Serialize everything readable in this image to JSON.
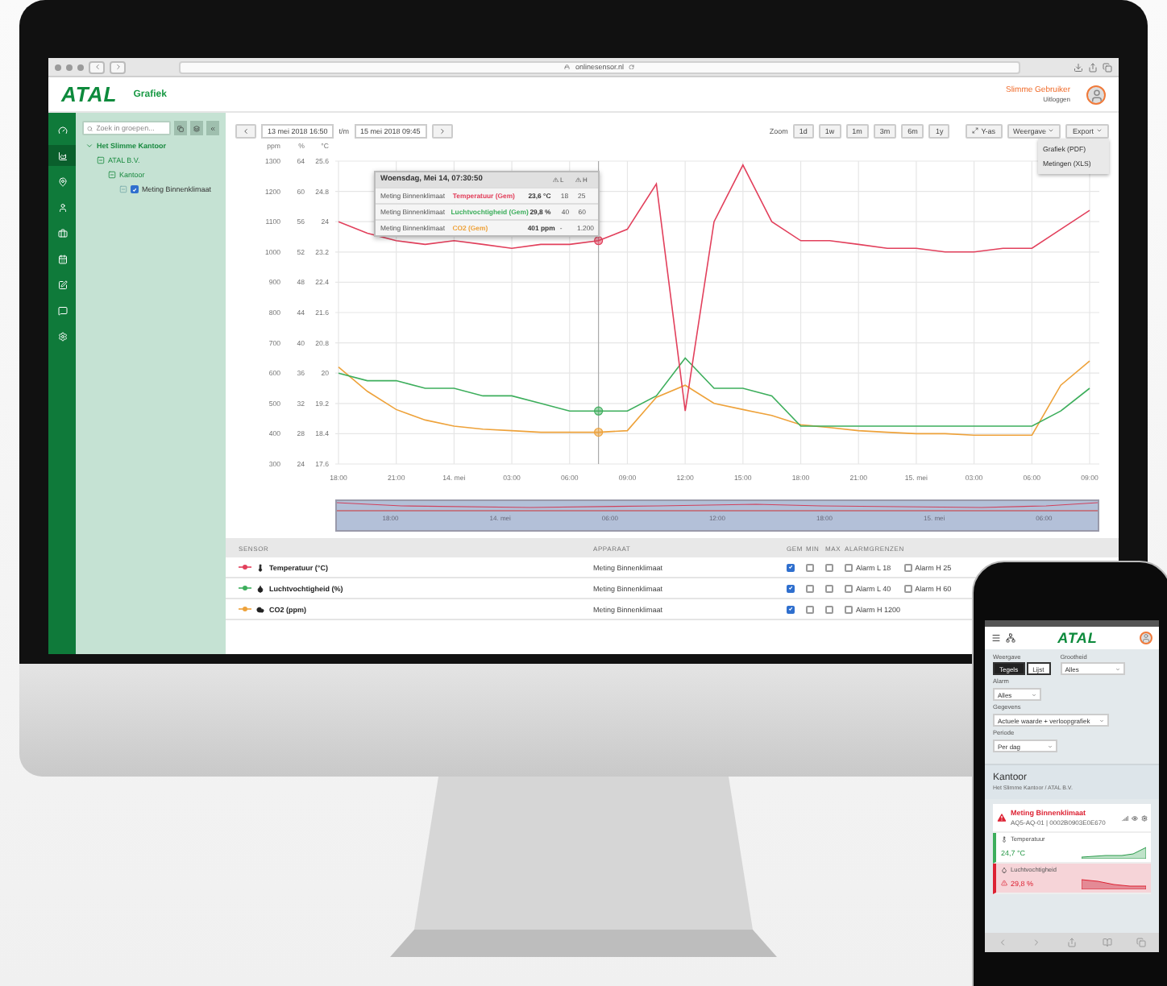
{
  "browser": {
    "url": "onlinesensor.nl"
  },
  "header": {
    "logo": "ATAL",
    "page_title": "Grafiek",
    "user_name": "Slimme Gebruiker",
    "logout": "Uitloggen"
  },
  "rail": {
    "items": [
      {
        "kind": "gauge",
        "selected": false
      },
      {
        "kind": "chart",
        "selected": true
      },
      {
        "kind": "pin",
        "selected": false
      },
      {
        "kind": "user",
        "selected": false
      },
      {
        "kind": "case",
        "selected": false
      },
      {
        "kind": "calendar",
        "selected": false
      },
      {
        "kind": "edit",
        "selected": false
      },
      {
        "kind": "message",
        "selected": false
      },
      {
        "kind": "settings",
        "selected": false
      }
    ]
  },
  "sidebar": {
    "search_placeholder": "Zoek in groepen...",
    "tree": [
      {
        "label": "Het Slimme Kantoor",
        "expanded": true,
        "children": [
          {
            "label": "ATAL B.V.",
            "expanded": true,
            "children": [
              {
                "label": "Kantoor",
                "expanded": true,
                "children": [
                  {
                    "label": "Meting Binnenklimaat",
                    "checked": true
                  }
                ]
              }
            ]
          }
        ]
      }
    ]
  },
  "toolbar": {
    "from": "13 mei 2018 16:50",
    "between": "t/m",
    "to": "15 mei 2018 09:45",
    "zoom_label": "Zoom",
    "zoom_options": [
      {
        "label": "1d",
        "selected": false
      },
      {
        "label": "1w",
        "selected": false
      },
      {
        "label": "1m",
        "selected": false
      },
      {
        "label": "3m",
        "selected": false
      },
      {
        "label": "6m",
        "selected": false
      },
      {
        "label": "1y",
        "selected": false
      }
    ],
    "yaxis_button": "Y-as",
    "view_menu": "Weergave",
    "export_menu": "Export",
    "export_options": [
      "Grafiek (PDF)",
      "Metingen (XLS)"
    ]
  },
  "chart": {
    "axes": [
      {
        "chart_data": {
          "type": "line",
          "ylabel": "ppm",
          "grid": true,
          "categories": [
            "18:00",
            null,
            "21:00",
            null,
            "14. mei",
            null,
            "03:00",
            null,
            "06:00",
            null,
            "09:00",
            null,
            "12:00",
            null,
            "15:00",
            null,
            "18:00",
            null,
            "21:00",
            null,
            "15. mei",
            null,
            "03:00",
            null,
            "06:00",
            null,
            "09:00"
          ],
          "ylim": [
            300,
            1300
          ],
          "yticks": [
            300,
            400,
            500,
            600,
            700,
            800,
            900,
            1000,
            1100,
            1200,
            1300
          ],
          "series": [
            {
              "color": "#eea23a",
              "values": [
                620,
                540,
                480,
                445,
                425,
                415,
                410,
                405,
                405,
                405,
                410,
                520,
                560,
                500,
                480,
                460,
                430,
                420,
                410,
                405,
                400,
                400,
                395,
                395,
                395,
                560,
                640
              ]
            }
          ]
        }
      },
      {
        "chart_data": {
          "type": "line",
          "ylabel": "%",
          "categories": [
            null,
            null,
            null,
            null,
            null,
            null,
            null,
            null,
            null,
            null,
            null,
            null,
            null,
            null,
            null,
            null,
            null,
            null,
            null,
            null,
            null,
            null,
            null,
            null,
            null,
            null,
            null
          ],
          "ylim": [
            24,
            64
          ],
          "yticks": [
            24,
            28,
            32,
            36,
            40,
            44,
            48,
            52,
            56,
            60,
            64
          ],
          "series": [
            {
              "color": "#3dae5c",
              "values": [
                36,
                35,
                35,
                34,
                34,
                33,
                33,
                32,
                31,
                31,
                31,
                33,
                38,
                34,
                34,
                33,
                29,
                29,
                29,
                29,
                29,
                29,
                29,
                29,
                29,
                31,
                34
              ]
            }
          ]
        }
      },
      {
        "chart_data": {
          "type": "line",
          "ylabel": "°C",
          "categories": [
            null,
            null,
            null,
            null,
            null,
            null,
            null,
            null,
            null,
            null,
            null,
            null,
            null,
            null,
            null,
            null,
            null,
            null,
            null,
            null,
            null,
            null,
            null,
            null,
            null,
            null,
            null
          ],
          "ylim": [
            17.6,
            25.6
          ],
          "yticks": [
            17.6,
            18.4,
            19.2,
            20,
            20.8,
            21.6,
            22.4,
            23.2,
            24,
            24.8,
            25.6
          ],
          "series": [
            {
              "color": "#e2405c",
              "values": [
                24.0,
                23.7,
                23.5,
                23.4,
                23.5,
                23.4,
                23.3,
                23.4,
                23.4,
                23.5,
                23.8,
                25.0,
                19.0,
                24.0,
                25.5,
                24.0,
                23.5,
                23.5,
                23.4,
                23.3,
                23.3,
                23.2,
                23.2,
                23.3,
                23.3,
                23.8,
                24.3
              ]
            }
          ]
        }
      }
    ],
    "tooltip": {
      "title": "Woensdag, Mei 14, 07:30:50",
      "low_header": "L",
      "high_header": "H",
      "rows": [
        {
          "device": "Meting Binnenklimaat",
          "sensor": "Temperatuur (Gem)",
          "color": "#e2405c",
          "value": "23,6 °C",
          "low": "18",
          "high": "25"
        },
        {
          "device": "Meting Binnenklimaat",
          "sensor": "Luchtvochtigheid (Gem)",
          "color": "#3dae5c",
          "value": "29,8 %",
          "low": "40",
          "high": "60"
        },
        {
          "device": "Meting Binnenklimaat",
          "sensor": "CO2 (Gem)",
          "color": "#eea23a",
          "value": "401 ppm",
          "low": "-",
          "high": "1.200"
        }
      ]
    },
    "navigator_labels": [
      "18:00",
      "14. mei",
      "06:00",
      "12:00",
      "18:00",
      "15. mei",
      "06:00"
    ]
  },
  "table": {
    "columns": [
      "SENSOR",
      "APPARAAT",
      "GEM",
      "MIN",
      "MAX",
      "ALARMGRENZEN"
    ],
    "rows": [
      {
        "kind": "temperature",
        "color": "#e2405c",
        "sensor": "Temperatuur (°C)",
        "device": "Meting Binnenklimaat",
        "gem": true,
        "min": false,
        "max": false,
        "alarms": [
          {
            "label": "Alarm L 18",
            "checked": false
          },
          {
            "label": "Alarm H 25",
            "checked": false
          }
        ]
      },
      {
        "kind": "humidity",
        "color": "#3dae5c",
        "sensor": "Luchtvochtigheid (%)",
        "device": "Meting Binnenklimaat",
        "gem": true,
        "min": false,
        "max": false,
        "alarms": [
          {
            "label": "Alarm L 40",
            "checked": false
          },
          {
            "label": "Alarm H 60",
            "checked": false
          }
        ]
      },
      {
        "kind": "co2",
        "color": "#eea23a",
        "sensor": "CO2 (ppm)",
        "device": "Meting Binnenklimaat",
        "gem": true,
        "min": false,
        "max": false,
        "alarms": [
          {
            "label": "Alarm H 1200",
            "checked": false
          }
        ]
      }
    ]
  },
  "phone": {
    "logo": "ATAL",
    "view_label": "Weergave",
    "view_options": [
      {
        "label": "Tegels",
        "selected": true
      },
      {
        "label": "Lijst",
        "selected": false
      }
    ],
    "quantity_label": "Grootheid",
    "quantity_value": "Alles",
    "alarm_label": "Alarm",
    "alarm_value": "Alles",
    "data_label": "Gegevens",
    "data_value": "Actuele waarde + verloopgrafiek",
    "period_label": "Periode",
    "period_value": "Per dag",
    "group_title": "Kantoor",
    "group_path": "Het Slimme Kantoor / ATAL B.V.",
    "device_name": "Meting Binnenklimaat",
    "device_id": "AQ5-AQ-01 | 0002B0903E0E670",
    "readings": [
      {
        "kind": "temperature",
        "label": "Temperatuur",
        "value": "24,7 °C",
        "alarm": false
      },
      {
        "kind": "humidity",
        "label": "Luchtvochtigheid",
        "value": "29,8 %",
        "alarm": true
      }
    ]
  }
}
